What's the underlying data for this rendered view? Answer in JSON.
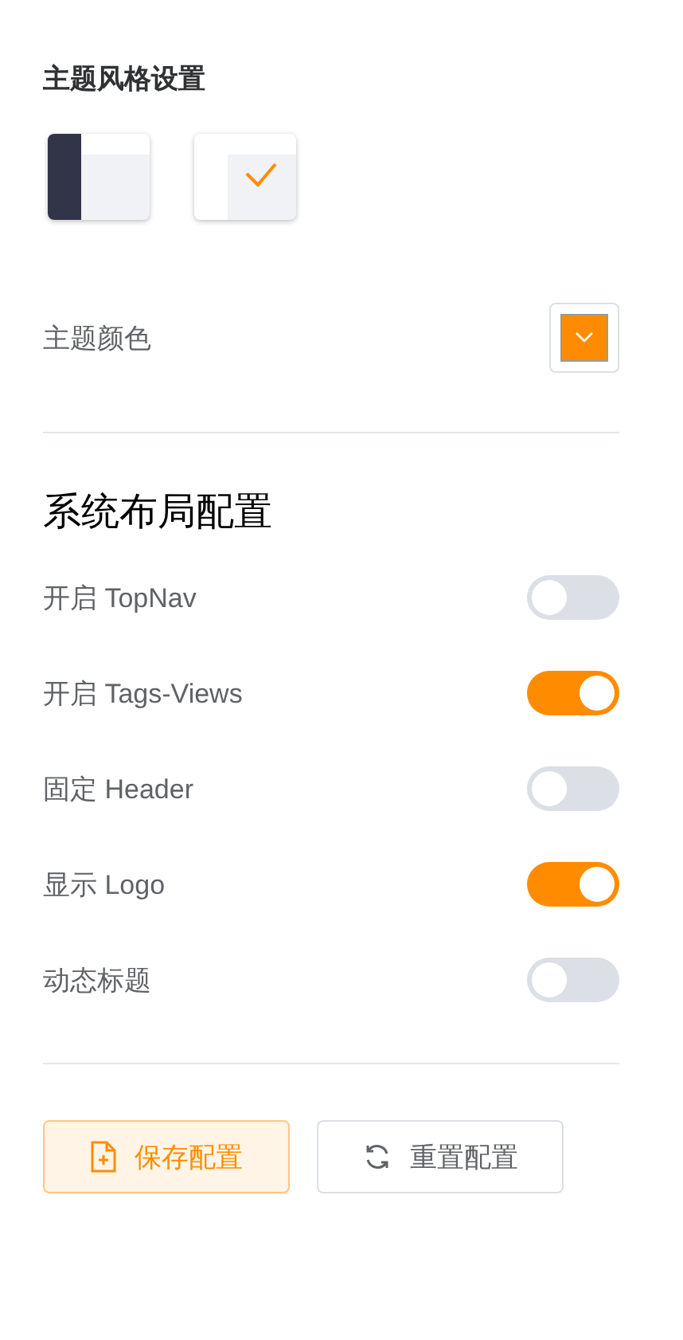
{
  "theme_style": {
    "title": "主题风格设置",
    "options": [
      {
        "kind": "dark",
        "selected": false
      },
      {
        "kind": "light",
        "selected": true
      }
    ]
  },
  "theme_color": {
    "label": "主题颜色",
    "color": "#ff8c00"
  },
  "layout": {
    "title": "系统布局配置",
    "settings": [
      {
        "label": "开启 TopNav",
        "on": false
      },
      {
        "label": "开启 Tags-Views",
        "on": true
      },
      {
        "label": "固定 Header",
        "on": false
      },
      {
        "label": "显示 Logo",
        "on": true
      },
      {
        "label": "动态标题",
        "on": false
      }
    ]
  },
  "buttons": [
    {
      "kind": "save",
      "label": "保存配置"
    },
    {
      "kind": "reset",
      "label": "重置配置"
    }
  ]
}
